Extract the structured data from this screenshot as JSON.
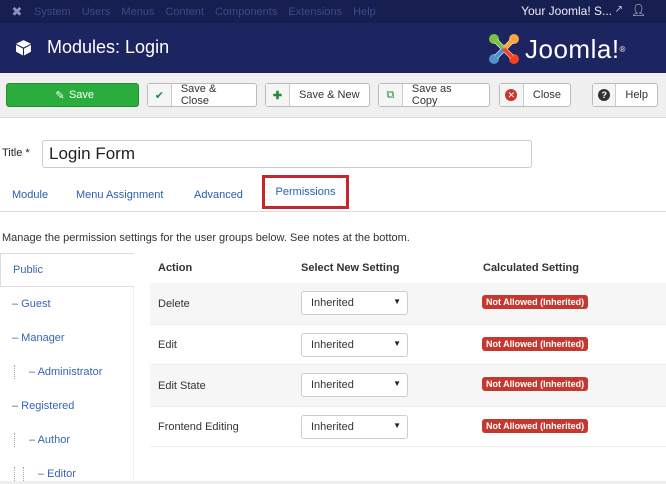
{
  "topnav": {
    "menu": [
      "System",
      "Users",
      "Menus",
      "Content",
      "Components",
      "Extensions",
      "Help"
    ],
    "site_name": "Your Joomla! S...",
    "external_icon": "external-link-icon",
    "user_icon": "user-icon"
  },
  "header": {
    "title": "Modules: Login",
    "brand": "Joomla!",
    "brand_reg": "®"
  },
  "toolbar": {
    "save_label": "Save",
    "save_close_label": "Save & Close",
    "save_new_label": "Save & New",
    "save_copy_label": "Save as Copy",
    "close_label": "Close",
    "help_label": "Help"
  },
  "form": {
    "title_label": "Title *",
    "title_value": "Login Form"
  },
  "tabs": [
    "Module",
    "Menu Assignment",
    "Advanced",
    "Permissions"
  ],
  "intro_text": "Manage the permission settings for the user groups below. See notes at the bottom.",
  "groups": [
    {
      "label": "Public",
      "depth": 0
    },
    {
      "label": "– Guest",
      "depth": 0
    },
    {
      "label": "– Manager",
      "depth": 0
    },
    {
      "label": "– Administrator",
      "depth": 1
    },
    {
      "label": "– Registered",
      "depth": 0
    },
    {
      "label": "– Author",
      "depth": 1
    },
    {
      "label": "– Editor",
      "depth": 2
    }
  ],
  "table": {
    "headers": {
      "action": "Action",
      "setting": "Select New Setting",
      "calculated": "Calculated Setting"
    },
    "rows": [
      {
        "action": "Delete",
        "setting": "Inherited",
        "calculated": "Not Allowed (Inherited)"
      },
      {
        "action": "Edit",
        "setting": "Inherited",
        "calculated": "Not Allowed (Inherited)"
      },
      {
        "action": "Edit State",
        "setting": "Inherited",
        "calculated": "Not Allowed (Inherited)"
      },
      {
        "action": "Frontend Editing",
        "setting": "Inherited",
        "calculated": "Not Allowed (Inherited)"
      }
    ]
  },
  "colors": {
    "topnav_bg": "#171f51",
    "header_bg": "#1d2560",
    "save_green": "#2aad3c",
    "badge_red": "#c4382f",
    "active_tab_outline": "#c4282d",
    "link_blue": "#2a5db0"
  }
}
